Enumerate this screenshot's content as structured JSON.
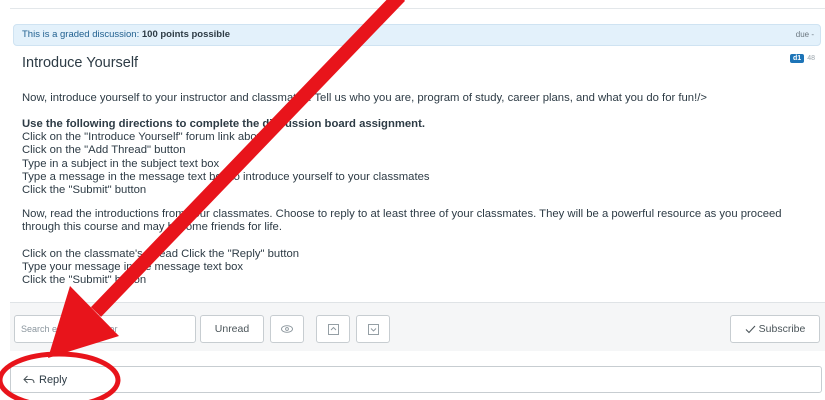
{
  "banner": {
    "label": "This is a graded discussion:",
    "points": "100 points possible",
    "due": "due -"
  },
  "topic": {
    "title": "Introduce Yourself",
    "badge_unread": "d1",
    "badge_total": "48"
  },
  "content": {
    "intro": "Now, introduce yourself to your instructor and classmates. Tell us who you are, program of study, career plans, and what you do for fun!/>",
    "directions_heading": "Use the following directions to complete the discussion board assignment.",
    "steps": [
      "Click on the \"Introduce Yourself\" forum link above",
      "Click on the \"Add Thread\" button",
      "Type in a subject in the subject text box",
      "Type a message in the message text box to introduce yourself to your classmates",
      "Click the \"Submit\" button"
    ],
    "read_para": "Now, read the introductions from your classmates. Choose to reply to at least three of your classmates. They will be a powerful resource as you proceed through this course and may become friends for life.",
    "reply_steps": [
      "Click on the classmate's thread Click the \"Reply\" button",
      "Type your message in the message text box",
      "Click the \"Submit\" button"
    ]
  },
  "toolbar": {
    "search_placeholder": "Search entries or author",
    "unread_label": "Unread",
    "subscribe_label": "Subscribe"
  },
  "reply": {
    "label": "Reply"
  },
  "colors": {
    "annotation": "#e8141b",
    "banner_bg": "#e3f1fb",
    "accent": "#1d74b7"
  }
}
